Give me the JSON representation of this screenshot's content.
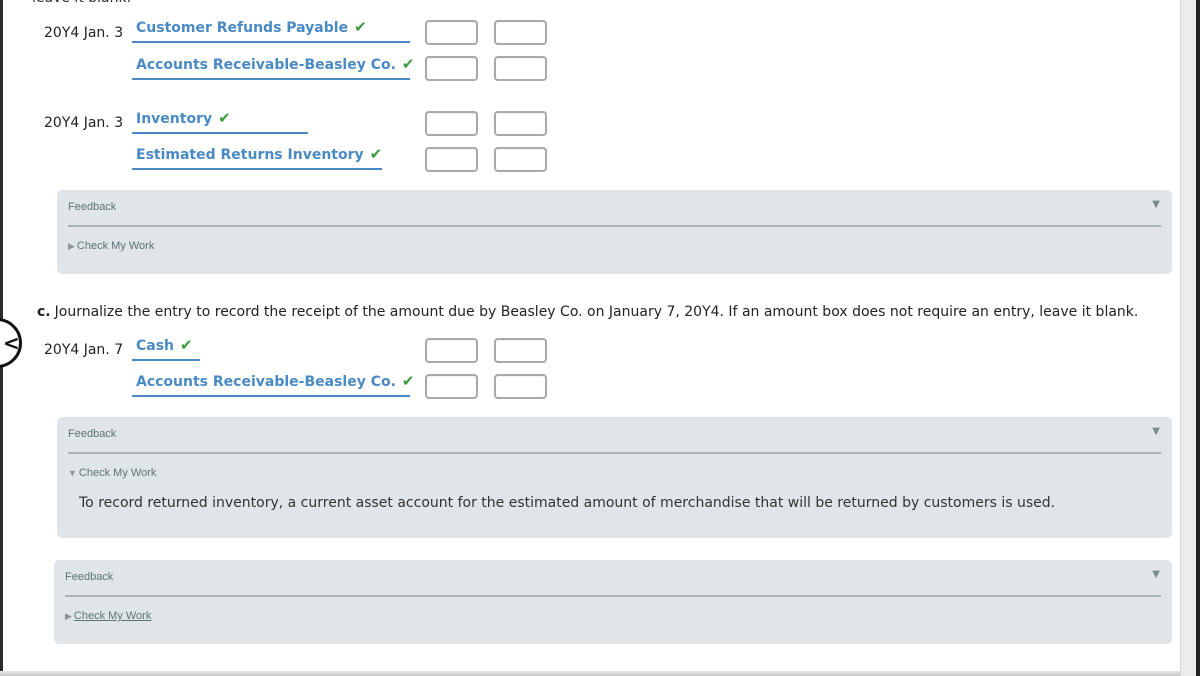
{
  "top_cut_text": "leave it blank.",
  "entries_ab": [
    {
      "date": "20Y4 Jan. 3",
      "lines": [
        {
          "account": "Customer Refunds Payable",
          "status": "correct"
        },
        {
          "account": "Accounts Receivable-Beasley Co.",
          "status": "correct"
        }
      ]
    },
    {
      "date": "20Y4 Jan. 3",
      "lines": [
        {
          "account": "Inventory",
          "status": "correct"
        },
        {
          "account": "Estimated Returns Inventory",
          "status": "correct"
        }
      ]
    }
  ],
  "check_glyph": "✔",
  "feedback_1": {
    "label": "Feedback",
    "toggle": "Check My Work",
    "expanded": false
  },
  "part_c": {
    "letter": "c.",
    "instruction": "Journalize the entry to record the receipt of the amount due by Beasley Co. on January 7, 20Y4. If an amount box does not require an entry, leave it blank.",
    "entry": {
      "date": "20Y4 Jan. 7",
      "lines": [
        {
          "account": "Cash",
          "status": "correct"
        },
        {
          "account": "Accounts Receivable-Beasley Co.",
          "status": "correct"
        }
      ]
    }
  },
  "feedback_2": {
    "label": "Feedback",
    "toggle": "Check My Work",
    "expanded": true,
    "text": "To record returned inventory, a current asset account for the estimated amount of merchandise that will be returned by customers is used."
  },
  "feedback_3": {
    "label": "Feedback",
    "toggle": "Check My Work",
    "expanded": false
  },
  "amount_fields": {
    "debit": "",
    "credit": ""
  },
  "icons": {
    "back": "chevron-left",
    "collapse": "triangle-down",
    "toggle_closed": "triangle-right",
    "toggle_open": "triangle-down"
  }
}
